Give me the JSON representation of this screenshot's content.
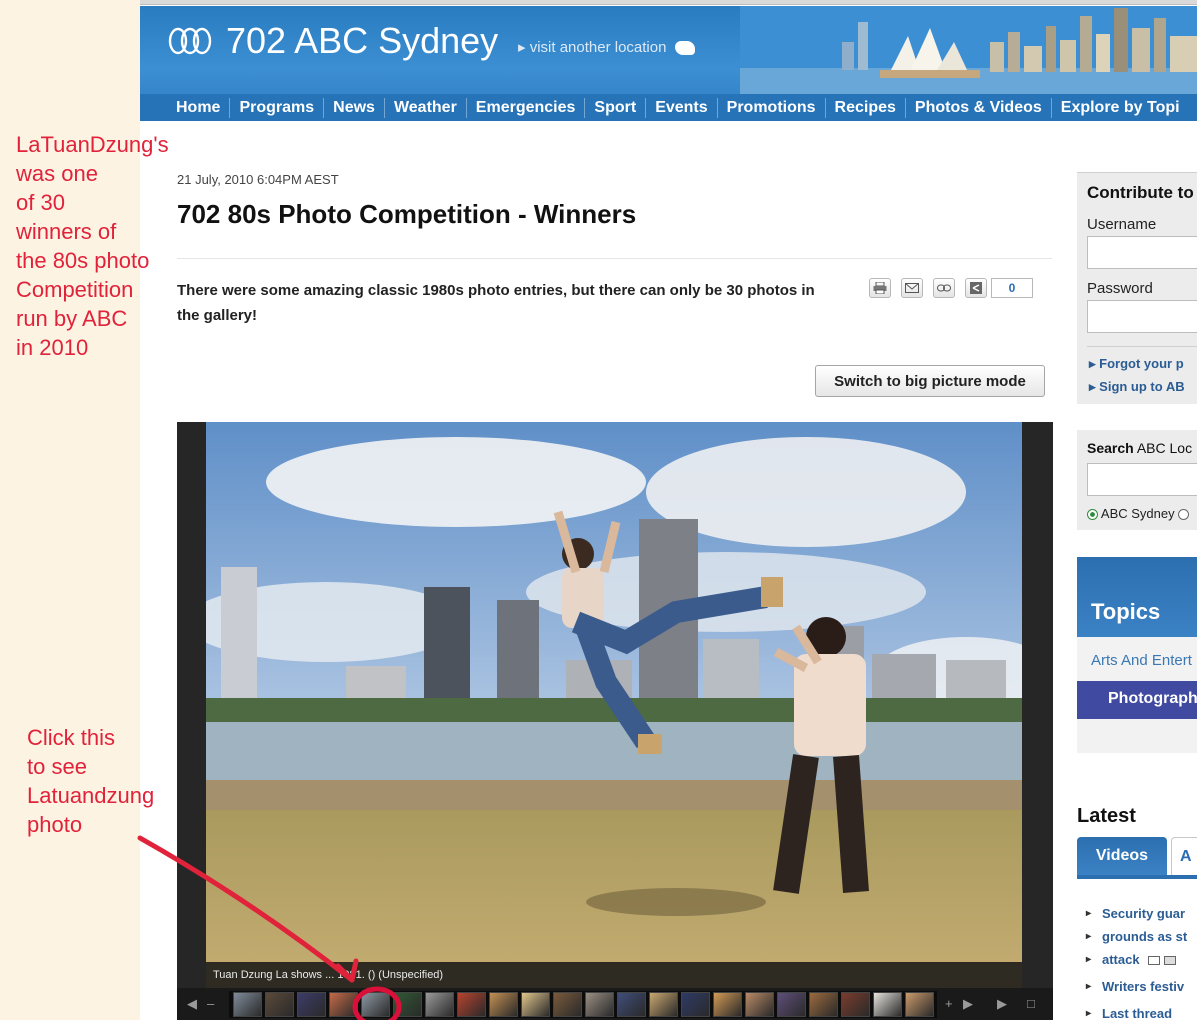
{
  "header": {
    "station_title": "702 ABC Sydney",
    "visit_link": "visit another location",
    "nav_items": [
      "Home",
      "Programs",
      "News",
      "Weather",
      "Emergencies",
      "Sport",
      "Events",
      "Promotions",
      "Recipes",
      "Photos & Videos",
      "Explore by Topi"
    ]
  },
  "annotations": {
    "note1": "LaTuanDzung's\nwas one\nof 30\nwinners of\nthe 80s photo\nCompetition\nrun by ABC\nin 2010",
    "note2": "Click this\nto see\nLatuandzung\nphoto"
  },
  "article": {
    "date": "21 July, 2010 6:04PM AEST",
    "title": "702 80s Photo Competition - Winners",
    "intro": "There were some amazing classic 1980s photo entries, but there can only be 30 photos in the gallery!",
    "share_count": "0",
    "big_picture_button": "Switch to big picture mode"
  },
  "gallery": {
    "caption": "Tuan Dzung La shows ... 1981. () (Unspecified)",
    "thumbnail_colors": [
      "#7f8c9a",
      "#5b4a3a",
      "#3c3c6a",
      "#c56a48",
      "#8d98a3",
      "#2f5a34",
      "#9a9a9a",
      "#b8432f",
      "#c29053",
      "#e1c58c",
      "#7a5a3b",
      "#9a8f83",
      "#3f4d7a",
      "#c9a770",
      "#2e3a66",
      "#d29a55",
      "#b88a66",
      "#5f4e7a",
      "#9c6a3e",
      "#7a3c2c",
      "#e6e2dc",
      "#c99a6b"
    ]
  },
  "sidebar": {
    "login_title": "Contribute to",
    "username_label": "Username",
    "password_label": "Password",
    "forgot_link": "Forgot your p",
    "signup_link": "Sign up to AB",
    "search_title_bold": "Search",
    "search_title_rest": "ABC Loc",
    "search_option": "ABC Sydney",
    "topics_title": "Topics",
    "topic_1": "Arts And Entert",
    "topic_2": "Photograph",
    "latest_title": "Latest",
    "tab_videos": "Videos",
    "tab_next": "A",
    "latest_items": [
      "Security guar",
      "grounds as st",
      "attack",
      "Writers festiv",
      "Last thread"
    ]
  },
  "colors": {
    "accent": "#2773b7",
    "annotation": "#e0233a",
    "panel_bg": "#fdf3e3"
  }
}
